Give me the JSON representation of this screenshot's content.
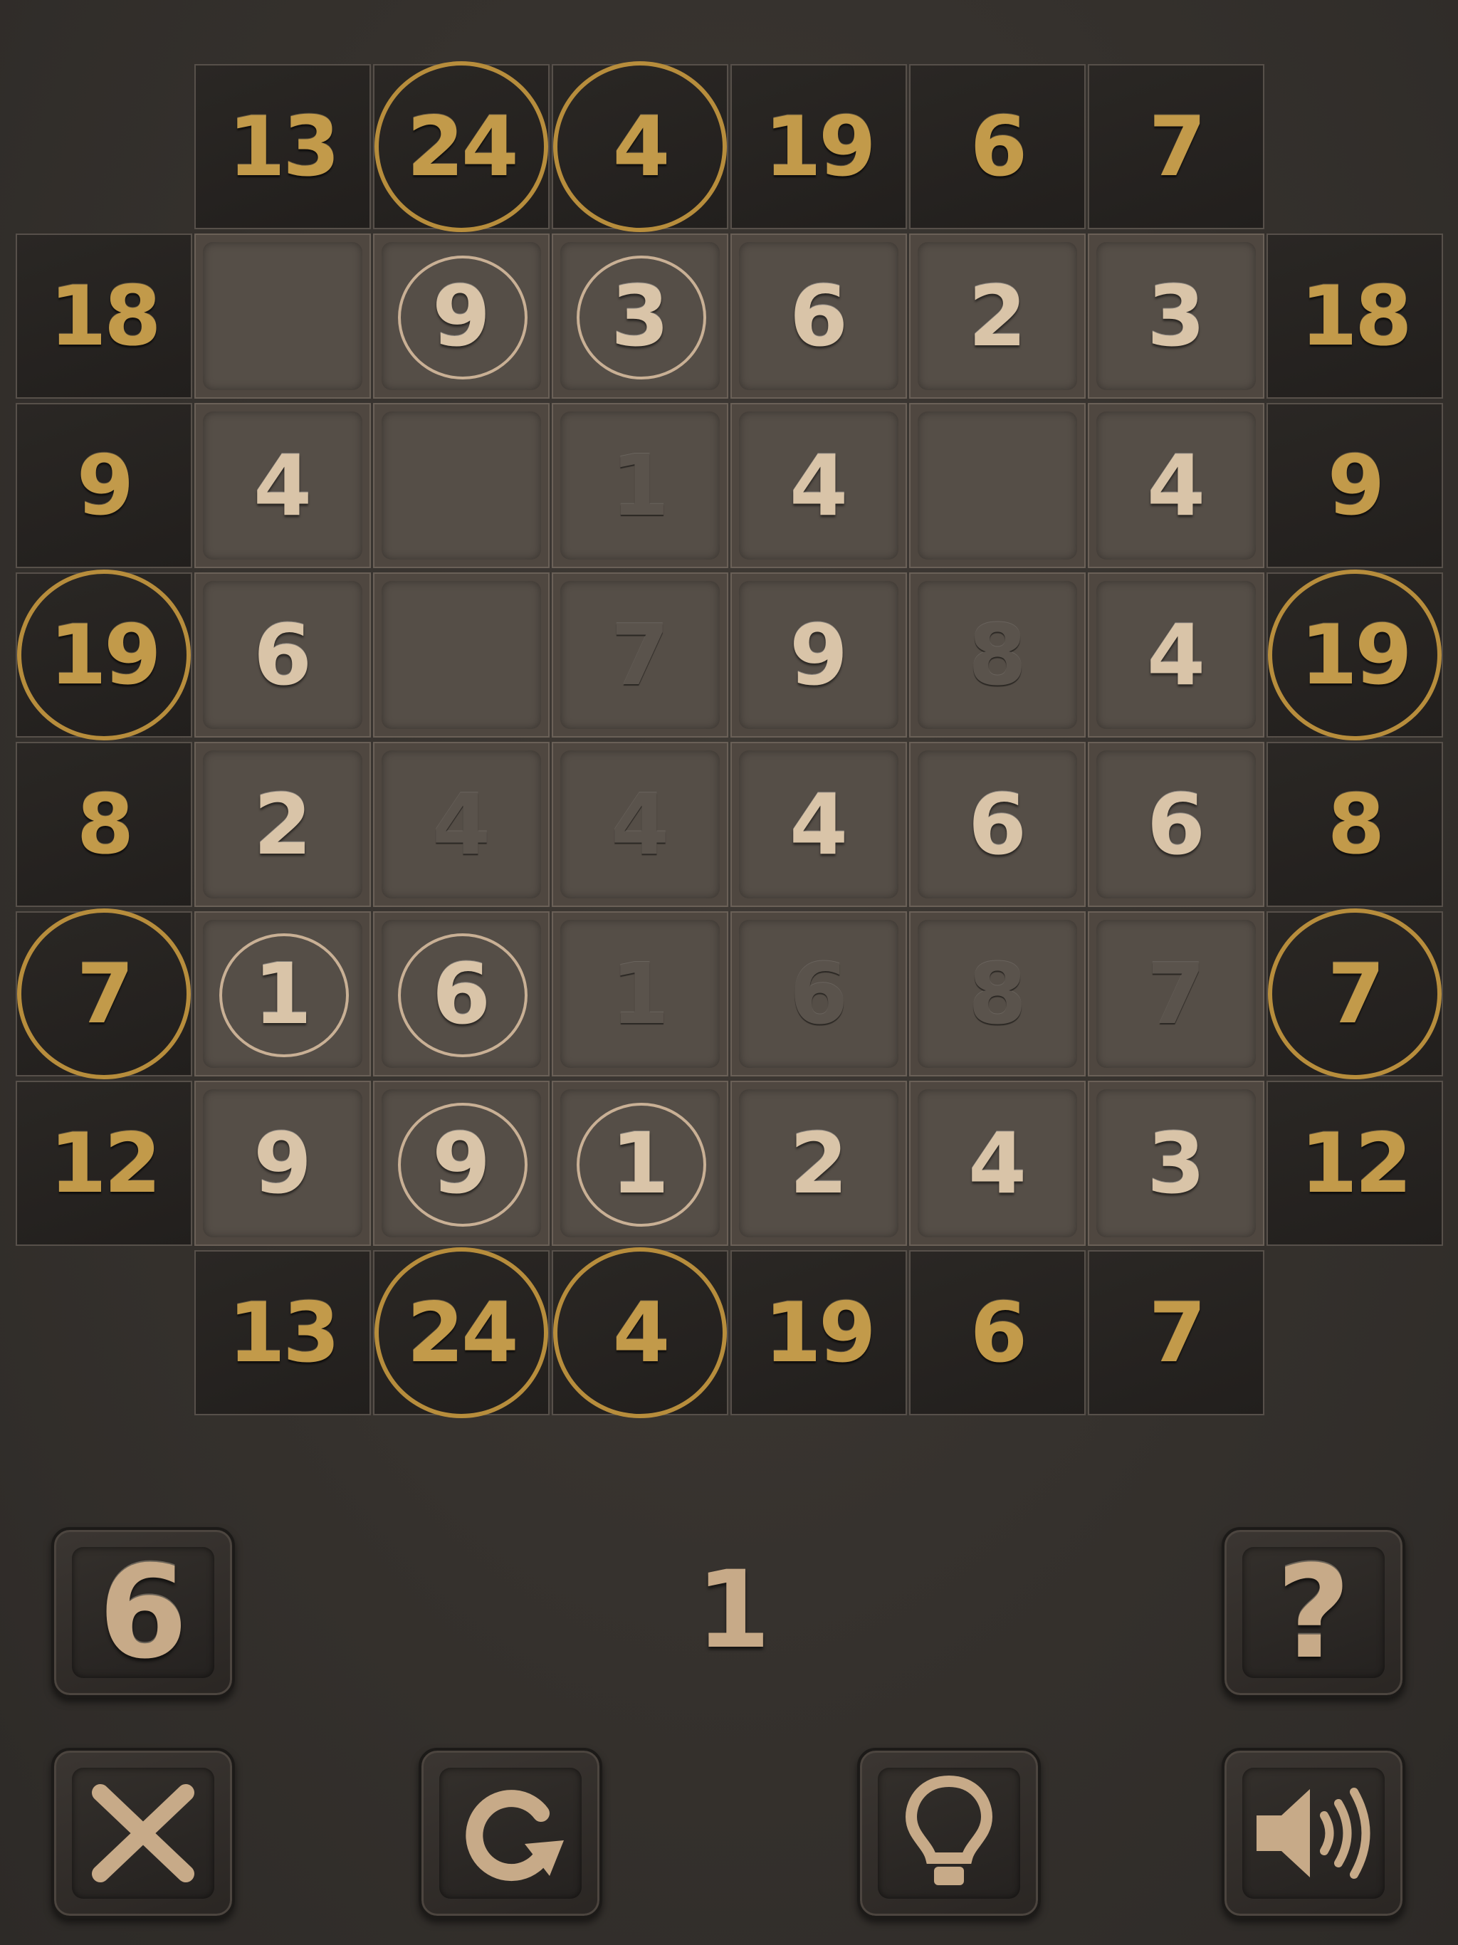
{
  "puzzle": {
    "top_clues": [
      {
        "v": "13",
        "c": false
      },
      {
        "v": "24",
        "c": true
      },
      {
        "v": "4",
        "c": true
      },
      {
        "v": "19",
        "c": false
      },
      {
        "v": "6",
        "c": false
      },
      {
        "v": "7",
        "c": false
      }
    ],
    "bottom_clues": [
      {
        "v": "13",
        "c": false
      },
      {
        "v": "24",
        "c": true
      },
      {
        "v": "4",
        "c": true
      },
      {
        "v": "19",
        "c": false
      },
      {
        "v": "6",
        "c": false
      },
      {
        "v": "7",
        "c": false
      }
    ],
    "left_clues": [
      {
        "v": "18",
        "c": false
      },
      {
        "v": "9",
        "c": false
      },
      {
        "v": "19",
        "c": true
      },
      {
        "v": "8",
        "c": false
      },
      {
        "v": "7",
        "c": true
      },
      {
        "v": "12",
        "c": false
      }
    ],
    "right_clues": [
      {
        "v": "18",
        "c": false
      },
      {
        "v": "9",
        "c": false
      },
      {
        "v": "19",
        "c": true
      },
      {
        "v": "8",
        "c": false
      },
      {
        "v": "7",
        "c": true
      },
      {
        "v": "12",
        "c": false
      }
    ],
    "grid": [
      [
        {
          "v": "",
          "s": "e"
        },
        {
          "v": "9",
          "s": "c"
        },
        {
          "v": "3",
          "s": "c"
        },
        {
          "v": "6",
          "s": "n"
        },
        {
          "v": "2",
          "s": "n"
        },
        {
          "v": "3",
          "s": "n"
        }
      ],
      [
        {
          "v": "4",
          "s": "n"
        },
        {
          "v": "",
          "s": "e"
        },
        {
          "v": "1",
          "s": "d"
        },
        {
          "v": "4",
          "s": "n"
        },
        {
          "v": "",
          "s": "e"
        },
        {
          "v": "4",
          "s": "n"
        }
      ],
      [
        {
          "v": "6",
          "s": "n"
        },
        {
          "v": "",
          "s": "e"
        },
        {
          "v": "7",
          "s": "d"
        },
        {
          "v": "9",
          "s": "n"
        },
        {
          "v": "8",
          "s": "d"
        },
        {
          "v": "4",
          "s": "n"
        }
      ],
      [
        {
          "v": "2",
          "s": "n"
        },
        {
          "v": "4",
          "s": "d"
        },
        {
          "v": "4",
          "s": "d"
        },
        {
          "v": "4",
          "s": "n"
        },
        {
          "v": "6",
          "s": "n"
        },
        {
          "v": "6",
          "s": "n"
        }
      ],
      [
        {
          "v": "1",
          "s": "c"
        },
        {
          "v": "6",
          "s": "c"
        },
        {
          "v": "1",
          "s": "d"
        },
        {
          "v": "6",
          "s": "d"
        },
        {
          "v": "8",
          "s": "d"
        },
        {
          "v": "7",
          "s": "d"
        }
      ],
      [
        {
          "v": "9",
          "s": "n"
        },
        {
          "v": "9",
          "s": "c"
        },
        {
          "v": "1",
          "s": "c"
        },
        {
          "v": "2",
          "s": "n"
        },
        {
          "v": "4",
          "s": "n"
        },
        {
          "v": "3",
          "s": "n"
        }
      ]
    ]
  },
  "controls": {
    "number_button_label": "6",
    "move_counter": "1",
    "help_button_label": "?",
    "close_icon": "close-x-icon",
    "restart_icon": "restart-arrow-icon",
    "hint_icon": "lightbulb-icon",
    "sound_icon": "speaker-icon"
  },
  "colors": {
    "clue_gold": "#c29a4a",
    "cell_text": "#d9c4a8",
    "cell_dim_text": "#5a534c",
    "background": "#35312d"
  }
}
